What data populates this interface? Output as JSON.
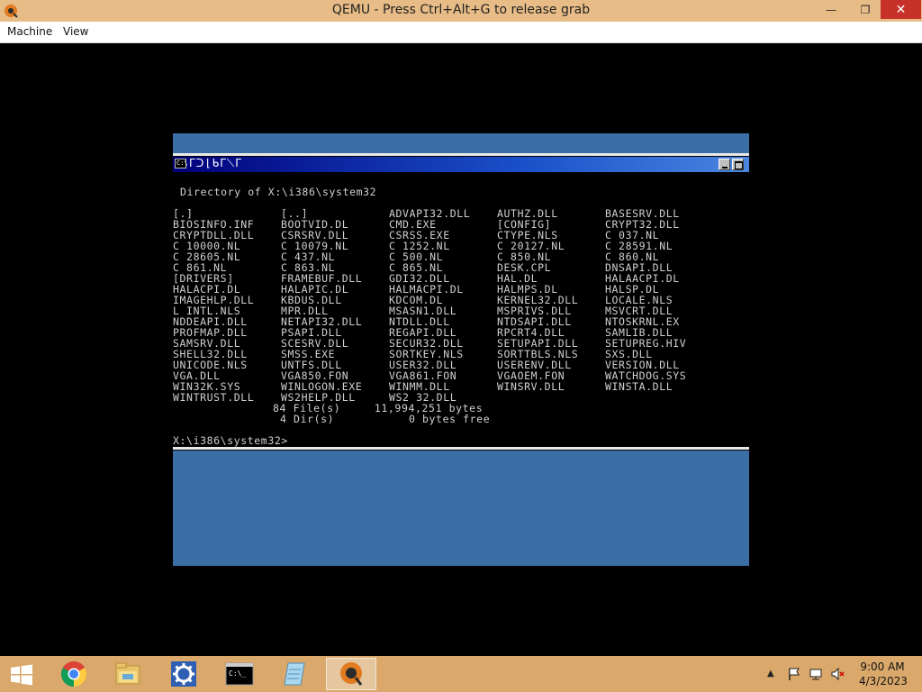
{
  "window": {
    "title": "QEMU - Press Ctrl+Alt+G to release grab",
    "minimize_glyph": "—",
    "maximize_glyph": "❐",
    "close_glyph": "✕"
  },
  "menubar": {
    "machine_label": "Machine",
    "view_label": "View"
  },
  "console": {
    "title_icon_text": "C:\\",
    "title_glyphs": "ᒥᑐ⌊ᑲᒥ⟍ᒥ",
    "directory_header": "Directory of X:\\i386\\system32",
    "files": [
      [
        "[.]",
        "[..]",
        "ADVAPI32.DLL",
        "AUTHZ.DLL",
        "BASESRV.DLL"
      ],
      [
        "BIOSINFO.INF",
        "BOOTVID.DL_",
        "CMD.EXE",
        "[CONFIG]",
        "CRYPT32.DLL"
      ],
      [
        "CRYPTDLL.DLL",
        "CSRSRV.DLL",
        "CSRSS.EXE",
        "CTYPE.NLS",
        "C_037.NL_"
      ],
      [
        "C_10000.NL_",
        "C_10079.NL_",
        "C_1252.NL_",
        "C_20127.NL_",
        "C_28591.NL_"
      ],
      [
        "C_28605.NL_",
        "C_437.NL_",
        "C_500.NL_",
        "C_850.NL_",
        "C_860.NL_"
      ],
      [
        "C_861.NL_",
        "C_863.NL_",
        "C_865.NL_",
        "DESK.CPL",
        "DNSAPI.DLL"
      ],
      [
        "[DRIVERS]",
        "FRAMEBUF.DLL",
        "GDI32.DLL",
        "HAL.DL_",
        "HALAACPI.DL_"
      ],
      [
        "HALACPI.DL_",
        "HALAPIC.DL_",
        "HALMACPI.DL_",
        "HALMPS.DL_",
        "HALSP.DL_"
      ],
      [
        "IMAGEHLP.DLL",
        "KBDUS.DLL",
        "KDCOM.DL_",
        "KERNEL32.DLL",
        "LOCALE.NLS"
      ],
      [
        "L_INTL.NLS",
        "MPR.DLL",
        "MSASN1.DLL",
        "MSPRIVS.DLL",
        "MSVCRT.DLL"
      ],
      [
        "NDDEAPI.DLL",
        "NETAPI32.DLL",
        "NTDLL.DLL",
        "NTDSAPI.DLL",
        "NTOSKRNL.EX_"
      ],
      [
        "PROFMAP.DLL",
        "PSAPI.DLL",
        "REGAPI.DLL",
        "RPCRT4.DLL",
        "SAMLIB.DLL"
      ],
      [
        "SAMSRV.DLL",
        "SCESRV.DLL",
        "SECUR32.DLL",
        "SETUPAPI.DLL",
        "SETUPREG.HIV"
      ],
      [
        "SHELL32.DLL",
        "SMSS.EXE",
        "SORTKEY.NLS",
        "SORTTBLS.NLS",
        "SXS.DLL"
      ],
      [
        "UNICODE.NLS",
        "UNTFS.DLL",
        "USER32.DLL",
        "USERENV.DLL",
        "VERSION.DLL"
      ],
      [
        "VGA.DLL",
        "VGA850.FON",
        "VGA861.FON",
        "VGAOEM.FON",
        "WATCHDOG.SYS"
      ],
      [
        "WIN32K.SYS",
        "WINLOGON.EXE",
        "WINMM.DLL",
        "WINSRV.DLL",
        "WINSTA.DLL"
      ],
      [
        "WINTRUST.DLL",
        "WS2HELP.DLL",
        "WS2_32.DLL",
        "",
        ""
      ]
    ],
    "summary_files": "84 File(s)     11,994,251 bytes",
    "summary_dirs": "4 Dir(s)           0 bytes free",
    "prompt": "X:\\i386\\system32>"
  },
  "taskbar": {
    "items": [
      "start-button",
      "chrome",
      "file-explorer",
      "settings",
      "command-prompt",
      "notepad",
      "qemu"
    ],
    "tray_arrow": "▲",
    "clock_time": "9:00 AM",
    "clock_date": "4/3/2023"
  },
  "colors": {
    "titlebar": "#e8bc86",
    "taskbar": "#d9a86a",
    "guest_blue": "#3a6ea5",
    "close_red": "#c7312a"
  }
}
